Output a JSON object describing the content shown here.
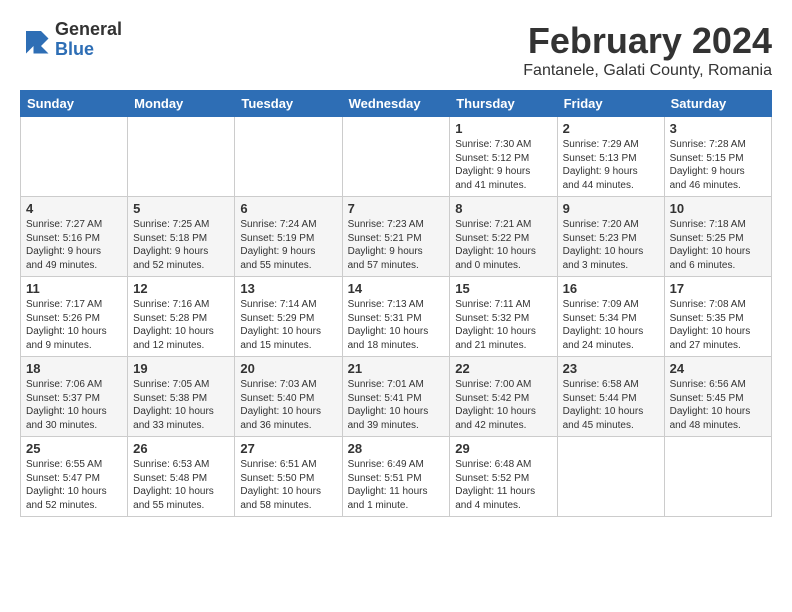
{
  "logo": {
    "general": "General",
    "blue": "Blue"
  },
  "header": {
    "month": "February 2024",
    "location": "Fantanele, Galati County, Romania"
  },
  "weekdays": [
    "Sunday",
    "Monday",
    "Tuesday",
    "Wednesday",
    "Thursday",
    "Friday",
    "Saturday"
  ],
  "weeks": [
    [
      {
        "day": "",
        "info": ""
      },
      {
        "day": "",
        "info": ""
      },
      {
        "day": "",
        "info": ""
      },
      {
        "day": "",
        "info": ""
      },
      {
        "day": "1",
        "info": "Sunrise: 7:30 AM\nSunset: 5:12 PM\nDaylight: 9 hours\nand 41 minutes."
      },
      {
        "day": "2",
        "info": "Sunrise: 7:29 AM\nSunset: 5:13 PM\nDaylight: 9 hours\nand 44 minutes."
      },
      {
        "day": "3",
        "info": "Sunrise: 7:28 AM\nSunset: 5:15 PM\nDaylight: 9 hours\nand 46 minutes."
      }
    ],
    [
      {
        "day": "4",
        "info": "Sunrise: 7:27 AM\nSunset: 5:16 PM\nDaylight: 9 hours\nand 49 minutes."
      },
      {
        "day": "5",
        "info": "Sunrise: 7:25 AM\nSunset: 5:18 PM\nDaylight: 9 hours\nand 52 minutes."
      },
      {
        "day": "6",
        "info": "Sunrise: 7:24 AM\nSunset: 5:19 PM\nDaylight: 9 hours\nand 55 minutes."
      },
      {
        "day": "7",
        "info": "Sunrise: 7:23 AM\nSunset: 5:21 PM\nDaylight: 9 hours\nand 57 minutes."
      },
      {
        "day": "8",
        "info": "Sunrise: 7:21 AM\nSunset: 5:22 PM\nDaylight: 10 hours\nand 0 minutes."
      },
      {
        "day": "9",
        "info": "Sunrise: 7:20 AM\nSunset: 5:23 PM\nDaylight: 10 hours\nand 3 minutes."
      },
      {
        "day": "10",
        "info": "Sunrise: 7:18 AM\nSunset: 5:25 PM\nDaylight: 10 hours\nand 6 minutes."
      }
    ],
    [
      {
        "day": "11",
        "info": "Sunrise: 7:17 AM\nSunset: 5:26 PM\nDaylight: 10 hours\nand 9 minutes."
      },
      {
        "day": "12",
        "info": "Sunrise: 7:16 AM\nSunset: 5:28 PM\nDaylight: 10 hours\nand 12 minutes."
      },
      {
        "day": "13",
        "info": "Sunrise: 7:14 AM\nSunset: 5:29 PM\nDaylight: 10 hours\nand 15 minutes."
      },
      {
        "day": "14",
        "info": "Sunrise: 7:13 AM\nSunset: 5:31 PM\nDaylight: 10 hours\nand 18 minutes."
      },
      {
        "day": "15",
        "info": "Sunrise: 7:11 AM\nSunset: 5:32 PM\nDaylight: 10 hours\nand 21 minutes."
      },
      {
        "day": "16",
        "info": "Sunrise: 7:09 AM\nSunset: 5:34 PM\nDaylight: 10 hours\nand 24 minutes."
      },
      {
        "day": "17",
        "info": "Sunrise: 7:08 AM\nSunset: 5:35 PM\nDaylight: 10 hours\nand 27 minutes."
      }
    ],
    [
      {
        "day": "18",
        "info": "Sunrise: 7:06 AM\nSunset: 5:37 PM\nDaylight: 10 hours\nand 30 minutes."
      },
      {
        "day": "19",
        "info": "Sunrise: 7:05 AM\nSunset: 5:38 PM\nDaylight: 10 hours\nand 33 minutes."
      },
      {
        "day": "20",
        "info": "Sunrise: 7:03 AM\nSunset: 5:40 PM\nDaylight: 10 hours\nand 36 minutes."
      },
      {
        "day": "21",
        "info": "Sunrise: 7:01 AM\nSunset: 5:41 PM\nDaylight: 10 hours\nand 39 minutes."
      },
      {
        "day": "22",
        "info": "Sunrise: 7:00 AM\nSunset: 5:42 PM\nDaylight: 10 hours\nand 42 minutes."
      },
      {
        "day": "23",
        "info": "Sunrise: 6:58 AM\nSunset: 5:44 PM\nDaylight: 10 hours\nand 45 minutes."
      },
      {
        "day": "24",
        "info": "Sunrise: 6:56 AM\nSunset: 5:45 PM\nDaylight: 10 hours\nand 48 minutes."
      }
    ],
    [
      {
        "day": "25",
        "info": "Sunrise: 6:55 AM\nSunset: 5:47 PM\nDaylight: 10 hours\nand 52 minutes."
      },
      {
        "day": "26",
        "info": "Sunrise: 6:53 AM\nSunset: 5:48 PM\nDaylight: 10 hours\nand 55 minutes."
      },
      {
        "day": "27",
        "info": "Sunrise: 6:51 AM\nSunset: 5:50 PM\nDaylight: 10 hours\nand 58 minutes."
      },
      {
        "day": "28",
        "info": "Sunrise: 6:49 AM\nSunset: 5:51 PM\nDaylight: 11 hours\nand 1 minute."
      },
      {
        "day": "29",
        "info": "Sunrise: 6:48 AM\nSunset: 5:52 PM\nDaylight: 11 hours\nand 4 minutes."
      },
      {
        "day": "",
        "info": ""
      },
      {
        "day": "",
        "info": ""
      }
    ]
  ]
}
